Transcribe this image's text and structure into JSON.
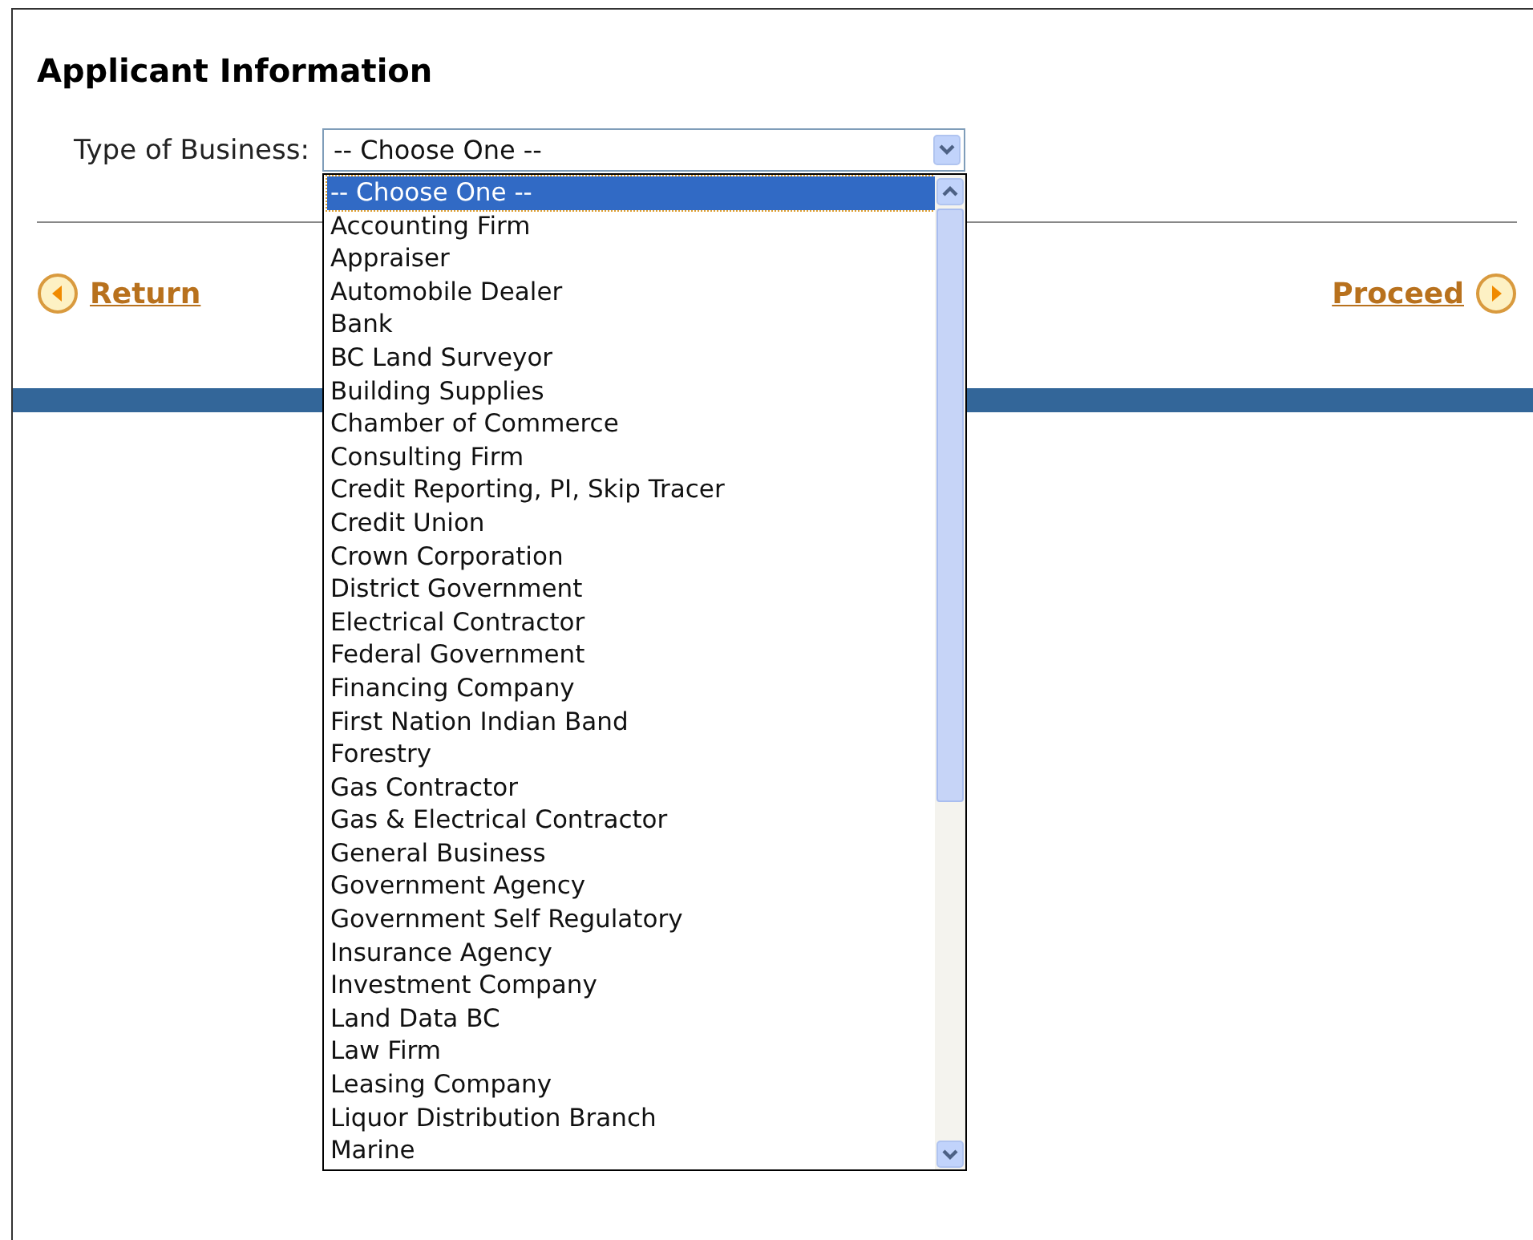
{
  "heading": "Applicant Information",
  "business_type": {
    "label": "Type of Business:",
    "value": "-- Choose One --",
    "expanded": true,
    "options": [
      {
        "label": "-- Choose One --",
        "selected": true
      },
      {
        "label": "Accounting Firm",
        "selected": false
      },
      {
        "label": "Appraiser",
        "selected": false
      },
      {
        "label": "Automobile Dealer",
        "selected": false
      },
      {
        "label": "Bank",
        "selected": false
      },
      {
        "label": "BC Land Surveyor",
        "selected": false
      },
      {
        "label": "Building Supplies",
        "selected": false
      },
      {
        "label": "Chamber of Commerce",
        "selected": false
      },
      {
        "label": "Consulting Firm",
        "selected": false
      },
      {
        "label": "Credit Reporting, PI, Skip Tracer",
        "selected": false
      },
      {
        "label": "Credit Union",
        "selected": false
      },
      {
        "label": "Crown Corporation",
        "selected": false
      },
      {
        "label": "District Government",
        "selected": false
      },
      {
        "label": "Electrical Contractor",
        "selected": false
      },
      {
        "label": "Federal Government",
        "selected": false
      },
      {
        "label": "Financing Company",
        "selected": false
      },
      {
        "label": "First Nation Indian Band",
        "selected": false
      },
      {
        "label": "Forestry",
        "selected": false
      },
      {
        "label": "Gas Contractor",
        "selected": false
      },
      {
        "label": "Gas & Electrical Contractor",
        "selected": false
      },
      {
        "label": "General Business",
        "selected": false
      },
      {
        "label": "Government Agency",
        "selected": false
      },
      {
        "label": "Government Self Regulatory",
        "selected": false
      },
      {
        "label": "Insurance Agency",
        "selected": false
      },
      {
        "label": "Investment Company",
        "selected": false
      },
      {
        "label": "Land Data BC",
        "selected": false
      },
      {
        "label": "Law Firm",
        "selected": false
      },
      {
        "label": "Leasing Company",
        "selected": false
      },
      {
        "label": "Liquor Distribution Branch",
        "selected": false
      },
      {
        "label": "Marine",
        "selected": false
      }
    ]
  },
  "navigation": {
    "back": "Return",
    "next": "Proceed"
  }
}
